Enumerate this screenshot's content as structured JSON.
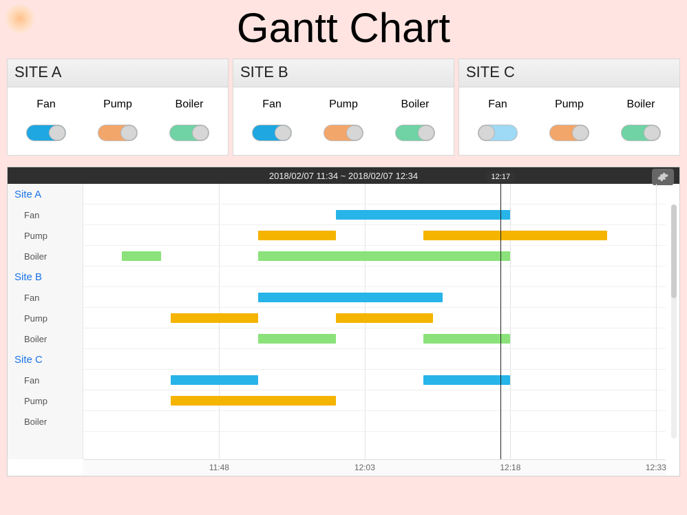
{
  "title": "Gantt Chart",
  "panels": [
    {
      "name": "SITE A",
      "controls": [
        {
          "label": "Fan",
          "on": true,
          "color": "#1ea7e1"
        },
        {
          "label": "Pump",
          "on": true,
          "color": "#f3a66a"
        },
        {
          "label": "Boiler",
          "on": true,
          "color": "#6fd3a5"
        }
      ]
    },
    {
      "name": "SITE B",
      "controls": [
        {
          "label": "Fan",
          "on": true,
          "color": "#1ea7e1"
        },
        {
          "label": "Pump",
          "on": true,
          "color": "#f3a66a"
        },
        {
          "label": "Boiler",
          "on": true,
          "color": "#6fd3a5"
        }
      ]
    },
    {
      "name": "SITE C",
      "controls": [
        {
          "label": "Fan",
          "on": false,
          "color": "#9ed9f5"
        },
        {
          "label": "Pump",
          "on": true,
          "color": "#f3a66a"
        },
        {
          "label": "Boiler",
          "on": true,
          "color": "#6fd3a5"
        }
      ]
    }
  ],
  "chart_data": {
    "type": "gantt",
    "time_range_label": "2018/02/07 11:34  ~  2018/02/07 12:34",
    "x_start_min": 694,
    "x_end_min": 754,
    "x_ticks": [
      {
        "min": 708,
        "label": "11:48"
      },
      {
        "min": 723,
        "label": "12:03"
      },
      {
        "min": 738,
        "label": "12:18"
      },
      {
        "min": 753,
        "label": "12:33"
      }
    ],
    "now_min": 737,
    "now_label": "12:17",
    "colors": {
      "Fan": "#27b4e8",
      "Pump": "#f4b400",
      "Boiler": "#8be27a"
    },
    "groups": [
      {
        "name": "Site A",
        "rows": [
          {
            "label": "Fan",
            "kind": "Fan",
            "bars": [
              [
                720,
                738
              ]
            ]
          },
          {
            "label": "Pump",
            "kind": "Pump",
            "bars": [
              [
                712,
                720
              ],
              [
                729,
                748
              ]
            ]
          },
          {
            "label": "Boiler",
            "kind": "Boiler",
            "bars": [
              [
                698,
                702
              ],
              [
                712,
                738
              ]
            ]
          }
        ]
      },
      {
        "name": "Site B",
        "rows": [
          {
            "label": "Fan",
            "kind": "Fan",
            "bars": [
              [
                712,
                731
              ]
            ]
          },
          {
            "label": "Pump",
            "kind": "Pump",
            "bars": [
              [
                703,
                712
              ],
              [
                720,
                730
              ]
            ]
          },
          {
            "label": "Boiler",
            "kind": "Boiler",
            "bars": [
              [
                712,
                720
              ],
              [
                729,
                738
              ]
            ]
          }
        ]
      },
      {
        "name": "Site C",
        "rows": [
          {
            "label": "Fan",
            "kind": "Fan",
            "bars": [
              [
                703,
                712
              ],
              [
                729,
                738
              ]
            ]
          },
          {
            "label": "Pump",
            "kind": "Pump",
            "bars": [
              [
                703,
                720
              ]
            ]
          },
          {
            "label": "Boiler",
            "kind": "Boiler",
            "bars": []
          }
        ]
      }
    ]
  }
}
